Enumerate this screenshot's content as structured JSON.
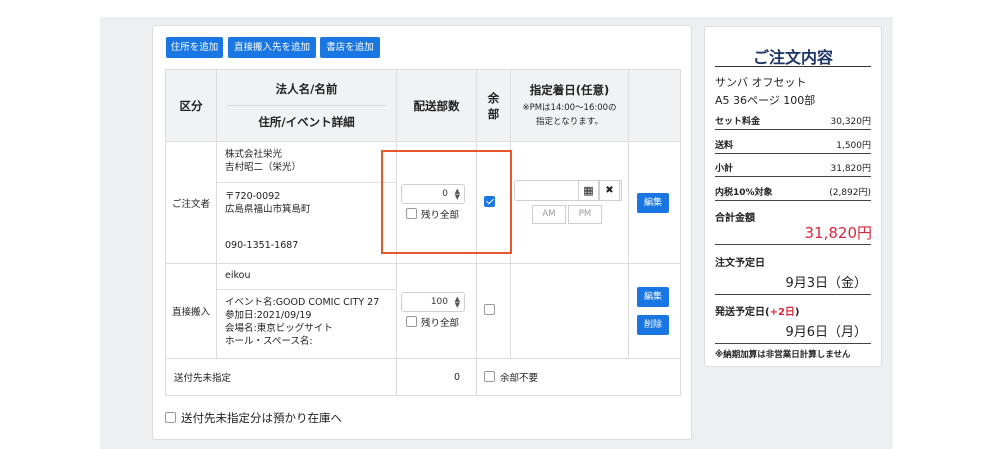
{
  "toolbar": {
    "add_address": "住所を追加",
    "add_direct": "直接搬入先を追加",
    "add_store": "書店を追加"
  },
  "table": {
    "headers": {
      "kubun": "区分",
      "name": "法人名/名前",
      "address": "住所/イベント詳細",
      "copies": "配送部数",
      "yobu_1": "余",
      "yobu_2": "部",
      "date": "指定着日(任意)",
      "date_note_1": "※PMは14:00〜16:00の",
      "date_note_2": "指定となります。"
    },
    "rows": [
      {
        "kubun": "ご注文者",
        "name_1": "株式会社栄光",
        "name_2": "吉村昭二（栄光）",
        "addr_1": "〒720-0092",
        "addr_2": "広島県福山市箕島町",
        "phone": "090-1351-1687",
        "copies": "0",
        "remain_label": "残り全部",
        "remain_checked": false,
        "yobu_checked": true,
        "am": "AM",
        "pm": "PM",
        "edit": "編集"
      },
      {
        "kubun": "直接搬入",
        "name": "eikou",
        "detail_1": "イベント名:GOOD COMIC CITY 27",
        "detail_2": "参加日:2021/09/19",
        "detail_3": "会場名:東京ビッグサイト",
        "detail_4": "ホール・スペース名:",
        "copies": "100",
        "remain_label": "残り全部",
        "remain_checked": false,
        "yobu_checked": false,
        "edit": "編集",
        "delete": "削除"
      }
    ],
    "footer": {
      "label": "送付先未指定",
      "count": "0",
      "no_spare": "余部不要"
    }
  },
  "bottom_checkbox": "送付先未指定分は預かり在庫へ",
  "summary": {
    "title": "ご注文内容",
    "product": "サンバ オフセット",
    "spec": "A5  36ページ  100部",
    "rows": [
      {
        "k": "セット料金",
        "v": "30,320円"
      },
      {
        "k": "送料",
        "v": "1,500円"
      },
      {
        "k": "小計",
        "v": "31,820円"
      },
      {
        "k": "内税10%対象",
        "v": "(2,892円)"
      }
    ],
    "total_label": "合計金額",
    "total_value": "31,820円",
    "order_date_label": "注文予定日",
    "order_date": "9月3日（金）",
    "ship_label_prefix": "発送予定日(",
    "ship_label_plus": "+2日",
    "ship_label_suffix": ")",
    "ship_date": "9月6日（月）",
    "note": "※納期加算は非営業日計算しません",
    "accent_red": "#d9283a",
    "accent_blue": "#1a76e3"
  }
}
